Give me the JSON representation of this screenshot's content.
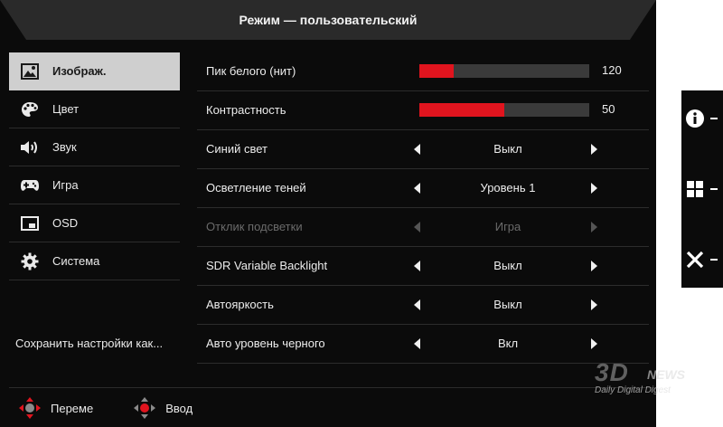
{
  "header": {
    "title": "Режим — пользовательский"
  },
  "sidebar": {
    "items": [
      {
        "label": "Изображ.",
        "icon": "image-icon",
        "active": true
      },
      {
        "label": "Цвет",
        "icon": "palette-icon",
        "active": false
      },
      {
        "label": "Звук",
        "icon": "speaker-icon",
        "active": false
      },
      {
        "label": "Игра",
        "icon": "gamepad-icon",
        "active": false
      },
      {
        "label": "OSD",
        "icon": "osd-window-icon",
        "active": false
      },
      {
        "label": "Система",
        "icon": "gear-icon",
        "active": false
      }
    ],
    "save_label": "Сохранить настройки как..."
  },
  "settings": {
    "peak_white": {
      "label": "Пик белого (нит)",
      "value": "120",
      "level": 0.2
    },
    "contrast": {
      "label": "Контрастность",
      "value": "50",
      "level": 0.5
    },
    "blue_light": {
      "label": "Синий свет",
      "value": "Выкл"
    },
    "shadow_boost": {
      "label": "Осветление теней",
      "value": "Уровень 1"
    },
    "backlight_response": {
      "label": "Отклик подсветки",
      "value": "Игра",
      "disabled": true
    },
    "sdr_backlight": {
      "label": "SDR Variable Backlight",
      "value": "Выкл"
    },
    "auto_brightness": {
      "label": "Автояркость",
      "value": "Выкл"
    },
    "auto_black_level": {
      "label": "Авто уровень черного",
      "value": "Вкл"
    }
  },
  "footer": {
    "move_label": "Переме",
    "enter_label": "Ввод"
  },
  "side_panel": {
    "buttons": [
      "info-icon",
      "menu-grid-icon",
      "close-icon"
    ]
  },
  "watermark": {
    "brand": "3D",
    "news": "NEWS",
    "tagline": "Daily Digital Digest"
  },
  "colors": {
    "accent": "#e0141e",
    "background": "#0b0b0b",
    "active_item": "#cfcfcf"
  }
}
